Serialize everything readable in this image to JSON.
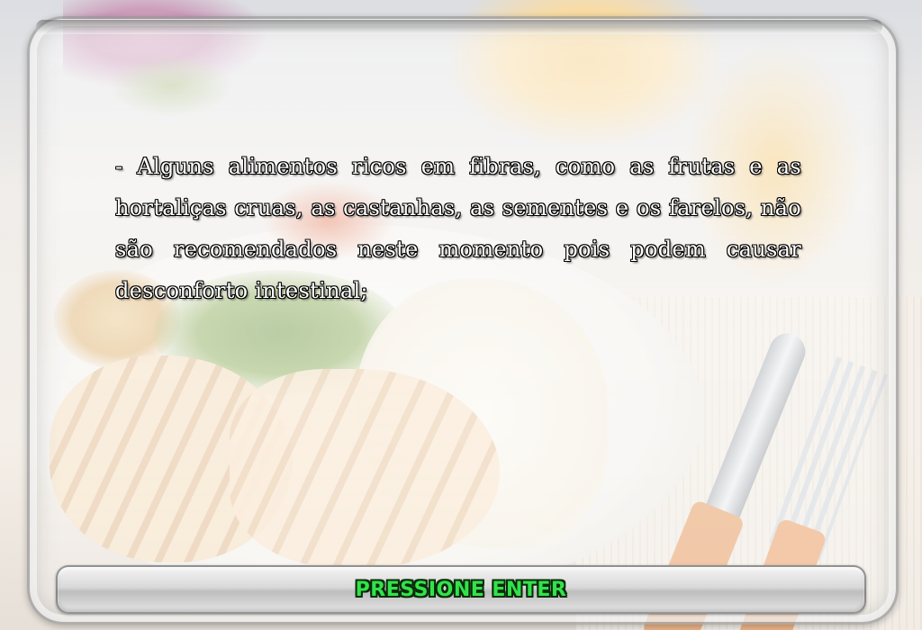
{
  "message": {
    "text": "- Alguns alimentos ricos em fibras, como as frutas e as hortaliças cruas, as castanhas, as sementes e os farelos, não são recomendados neste momento pois podem causar desconforto intestinal;"
  },
  "prompt": {
    "label": "PRESSIONE ENTER",
    "color": "#33e24a"
  },
  "background": {
    "image": "food-plate-photo"
  }
}
